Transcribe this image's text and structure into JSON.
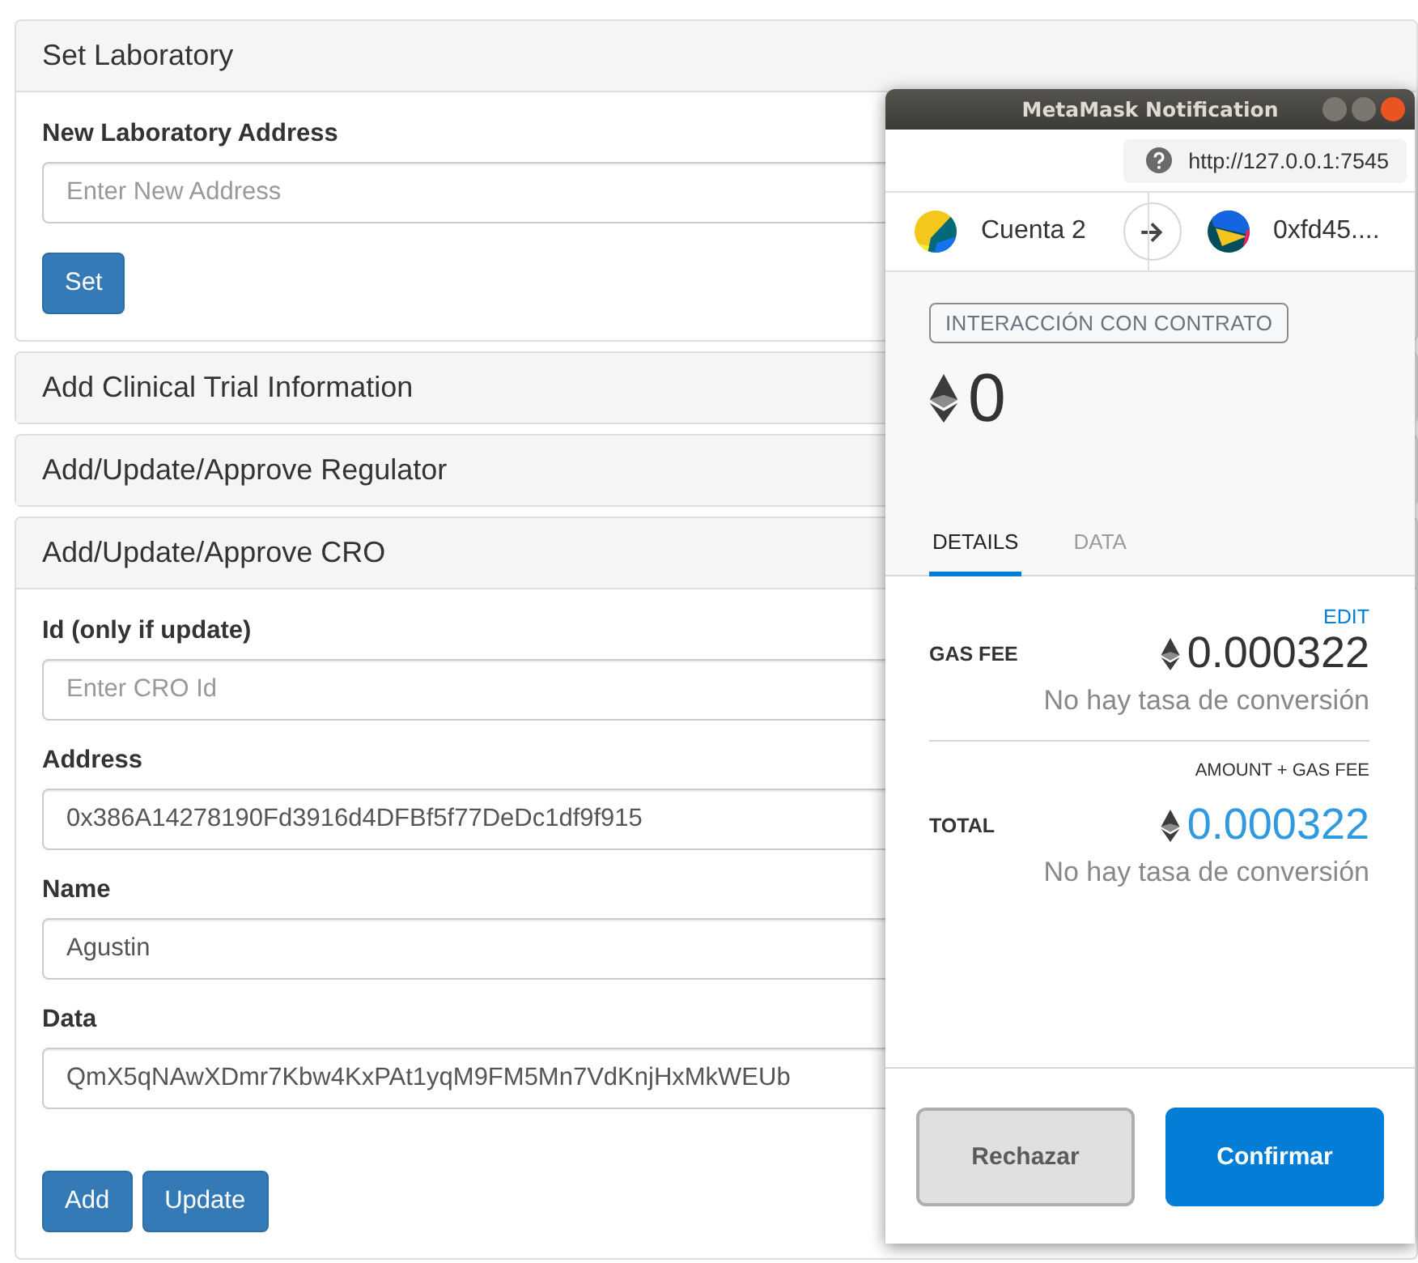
{
  "panels": [
    {
      "title": "Set Laboratory",
      "expanded": true,
      "fields": [
        {
          "label": "New Laboratory Address",
          "placeholder": "Enter New Address"
        }
      ],
      "buttons": [
        "Set"
      ]
    },
    {
      "title": "Add Clinical Trial Information",
      "expanded": false
    },
    {
      "title": "Add/Update/Approve Regulator",
      "expanded": false
    },
    {
      "title": "Add/Update/Approve CRO",
      "expanded": true,
      "fields": [
        {
          "label": "Id (only if update)",
          "placeholder": "Enter CRO Id"
        },
        {
          "label": "Address",
          "value": "0x386A14278190Fd3916d4DFBf5f77DeDc1df9f915"
        },
        {
          "label": "Name",
          "value": "Agustin"
        },
        {
          "label": "Data",
          "value": "QmX5qNAwXDmr7Kbw4KxPAt1yqM9FM5Mn7VdKnjHxMkWEUb"
        }
      ],
      "buttons": [
        "Add",
        "Update"
      ]
    }
  ],
  "popup": {
    "title": "MetaMask Notification",
    "origin": "http://127.0.0.1:7545",
    "from": "Cuenta 2",
    "to": "0xfd45....",
    "badge": "INTERACCIÓN CON CONTRATO",
    "amount": "0",
    "tabs": [
      {
        "label": "DETAILS",
        "selected": true
      },
      {
        "label": "DATA",
        "selected": false
      }
    ],
    "edit": "EDIT",
    "gas_fee": {
      "label": "GAS FEE",
      "value": "0.000322",
      "conversion": "No hay tasa de conversión"
    },
    "total": {
      "label": "TOTAL",
      "note": "AMOUNT + GAS FEE",
      "value": "0.000322",
      "conversion": "No hay tasa de conversión"
    },
    "buttons": [
      {
        "label": "Rechazar",
        "kind": "secondary"
      },
      {
        "label": "Confirmar",
        "kind": "primary"
      }
    ]
  }
}
